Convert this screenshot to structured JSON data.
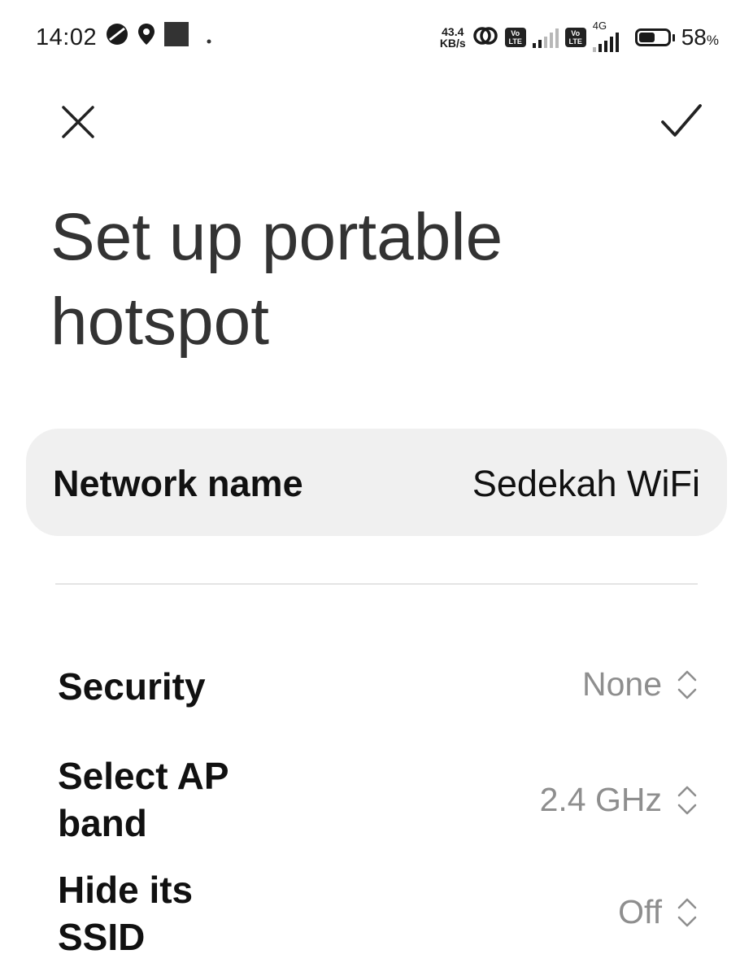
{
  "status_bar": {
    "time": "14:02",
    "net_speed_value": "43.4",
    "net_speed_unit": "KB/s",
    "volte_top": "Vo",
    "volte_bottom": "LTE",
    "network_type": "4G",
    "battery_level": 0.58,
    "battery_percent": "58",
    "battery_percent_sign": "%",
    "icons": [
      "data-saver-icon",
      "location-icon",
      "app-notification-icon",
      "notification-dot-icon",
      "hotspot-link-icon",
      "volte-icon",
      "signal-icon",
      "battery-icon"
    ]
  },
  "toolbar": {
    "close_icon": "close-icon",
    "confirm_icon": "checkmark-icon"
  },
  "page": {
    "title": "Set up portable hotspot"
  },
  "network_name": {
    "label": "Network name",
    "value": "Sedekah WiFi"
  },
  "settings": [
    {
      "label": "Security",
      "value": "None"
    },
    {
      "label": "Select AP band",
      "value": "2.4 GHz"
    },
    {
      "label": "Hide its SSID",
      "value": "Off"
    }
  ],
  "colors": {
    "background": "#ffffff",
    "row_highlight": "#f0f0f0",
    "secondary_text": "#8e8e8e",
    "title_text": "#333333"
  }
}
